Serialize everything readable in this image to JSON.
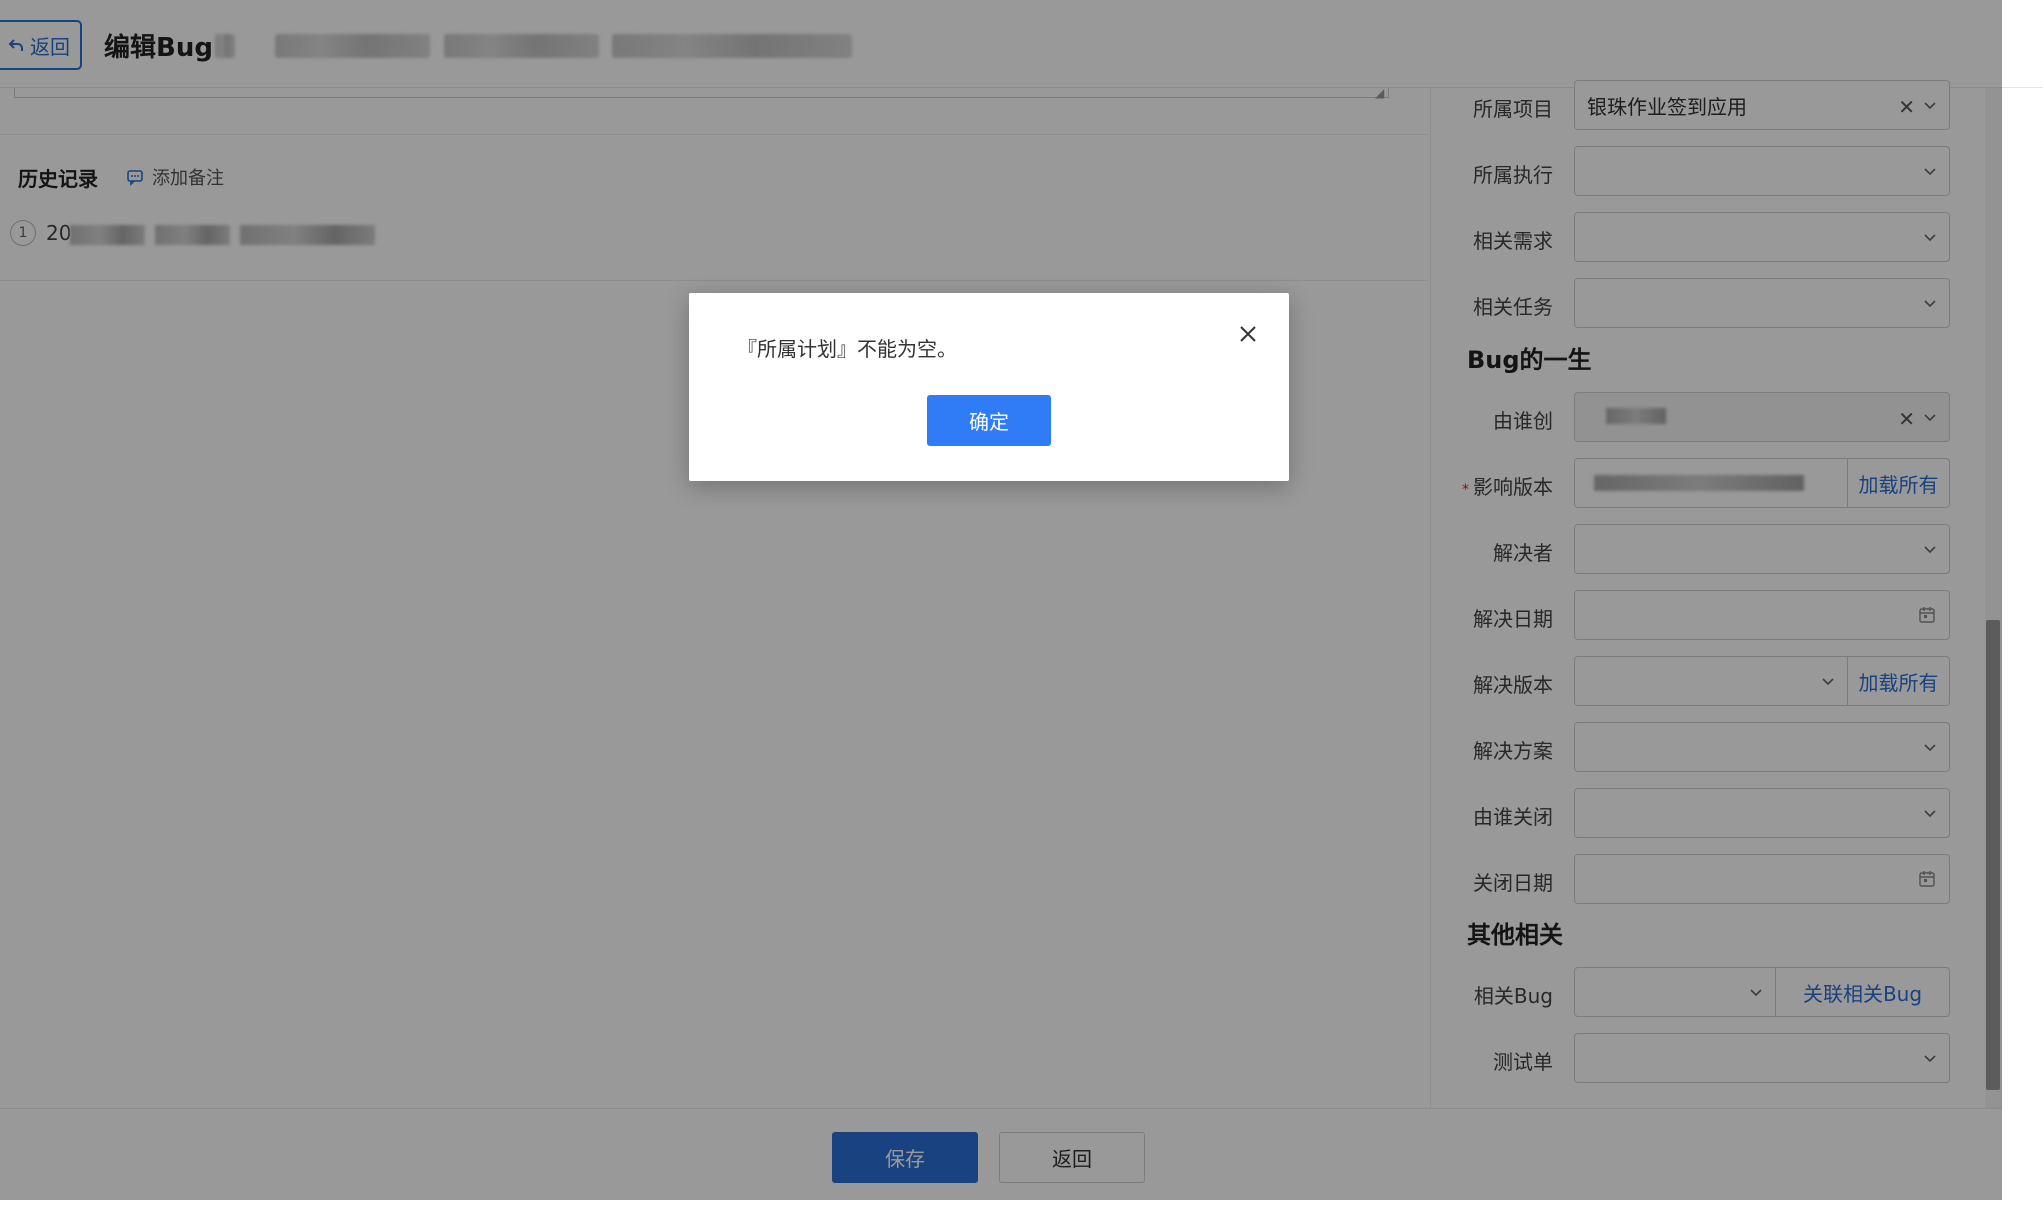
{
  "header": {
    "back_label": "返回",
    "title": "编辑Bug"
  },
  "history": {
    "title": "历史记录",
    "add_note_label": "添加备注",
    "items": [
      {
        "index": "1",
        "prefix": "20"
      }
    ]
  },
  "fields": {
    "project": {
      "label": "所属项目",
      "value": "银珠作业签到应用"
    },
    "execution": {
      "label": "所属执行",
      "value": ""
    },
    "story": {
      "label": "相关需求",
      "value": ""
    },
    "task": {
      "label": "相关任务",
      "value": ""
    }
  },
  "bug_life": {
    "title": "Bug的一生",
    "opened_by": {
      "label": "由谁创"
    },
    "affected_build": {
      "label": "影响版本",
      "required_mark": "*",
      "addon": "加载所有"
    },
    "resolved_by": {
      "label": "解决者"
    },
    "resolved_date": {
      "label": "解决日期"
    },
    "resolved_build": {
      "label": "解决版本",
      "addon": "加载所有"
    },
    "resolution": {
      "label": "解决方案"
    },
    "closed_by": {
      "label": "由谁关闭"
    },
    "closed_date": {
      "label": "关闭日期"
    }
  },
  "other": {
    "title": "其他相关",
    "related_bug": {
      "label": "相关Bug",
      "addon": "关联相关Bug"
    },
    "testtask": {
      "label": "测试单"
    }
  },
  "footer": {
    "save_label": "保存",
    "back_label": "返回"
  },
  "dialog": {
    "message": "『所属计划』不能为空。",
    "ok_label": "确定"
  },
  "colors": {
    "primary": "#2a6fd6",
    "ok_button": "#2f7cf6",
    "required": "#e02020"
  },
  "icons": {
    "back": "undo-arrow-icon",
    "note": "comment-icon",
    "dropdown": "chevron-down-icon",
    "clear": "close-icon",
    "date": "calendar-icon"
  }
}
